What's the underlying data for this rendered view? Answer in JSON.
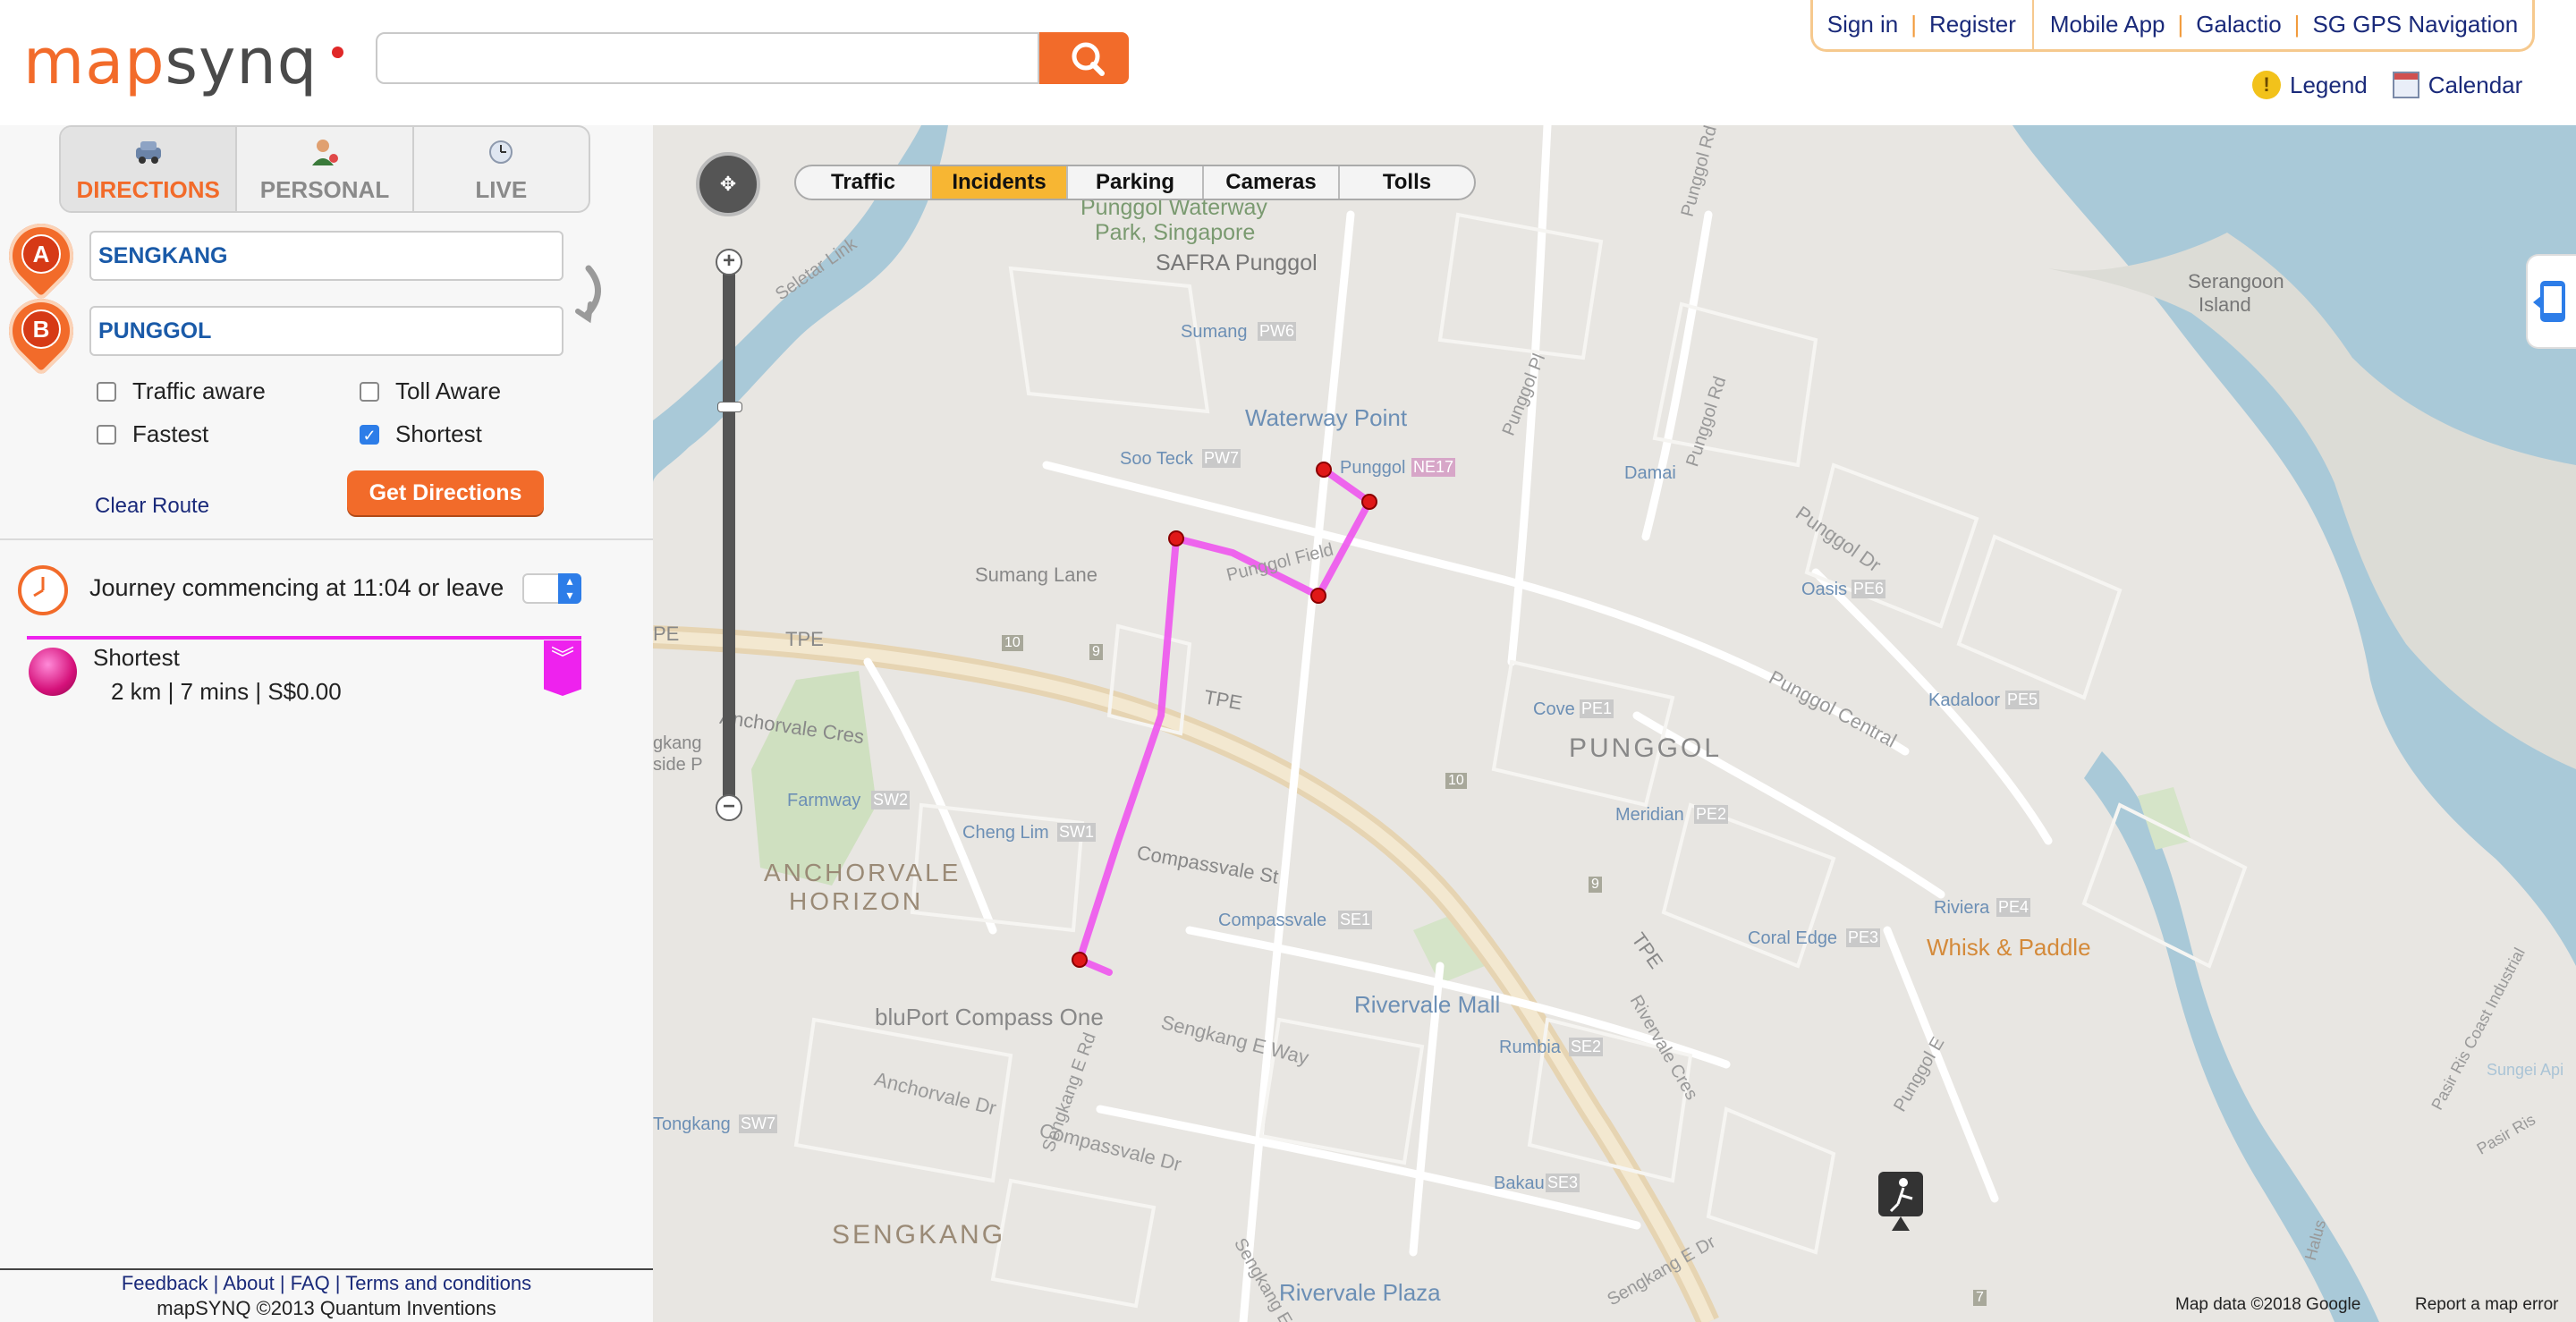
{
  "brand": {
    "logo_map": "map",
    "logo_synq": "synq"
  },
  "search": {
    "value": "",
    "placeholder": ""
  },
  "top_links": [
    "Sign in",
    "Register",
    "Mobile App",
    "Galactio",
    "SG GPS Navigation"
  ],
  "legend_label": "Legend",
  "calendar_label": "Calendar",
  "tabs": [
    {
      "label": "DIRECTIONS",
      "icon": "car-icon",
      "active": true
    },
    {
      "label": "PERSONAL",
      "icon": "person-icon",
      "active": false
    },
    {
      "label": "LIVE",
      "icon": "clock-icon",
      "active": false
    }
  ],
  "route": {
    "from_label": "A",
    "from_value": "SENGKANG",
    "to_label": "B",
    "to_value": "PUNGGOL",
    "options": [
      {
        "label": "Traffic aware",
        "checked": false
      },
      {
        "label": "Toll Aware",
        "checked": false
      },
      {
        "label": "Fastest",
        "checked": false
      },
      {
        "label": "Shortest",
        "checked": true
      }
    ],
    "clear_label": "Clear Route",
    "get_directions_label": "Get Directions"
  },
  "journey": {
    "text": "Journey commencing at 11:04 or leave",
    "select_value": ""
  },
  "result": {
    "name": "Shortest",
    "stats": "2 km | 7 mins | S$0.00",
    "color": "#ee22ee"
  },
  "footer": {
    "links": [
      "Feedback",
      "About",
      "FAQ",
      "Terms and conditions"
    ],
    "copyright": "mapSYNQ ©2013 Quantum Inventions"
  },
  "map": {
    "layers": [
      {
        "label": "Traffic",
        "active": false
      },
      {
        "label": "Incidents",
        "active": true
      },
      {
        "label": "Parking",
        "active": false
      },
      {
        "label": "Cameras",
        "active": false
      },
      {
        "label": "Tolls",
        "active": false
      }
    ],
    "zoom_level_fraction": 0.74,
    "labels": {
      "punggol_waterway": "Punggol Waterway",
      "park_singapore": "Park, Singapore",
      "safra": "SAFRA Punggol",
      "serangoon_island_1": "Serangoon",
      "serangoon_island_2": "Island",
      "seletar_link": "Seletar Link",
      "sumang": "Sumang",
      "pw6": "PW6",
      "waterway_point": "Waterway Point",
      "soo_teck": "Soo Teck",
      "pw7": "PW7",
      "punggol_stn": "Punggol",
      "ne17": "NE17",
      "damai": "Damai",
      "sumang_lane": "Sumang Lane",
      "punggol_field": "Punggol Field",
      "oasis": "Oasis",
      "pe6": "PE6",
      "tpe_1": "TPE",
      "tpe_2": "TPE",
      "tpe_3": "TPE",
      "tpe_4": "TPE",
      "r10a": "10",
      "r9a": "9",
      "r10b": "10",
      "r9b": "9",
      "r7": "7",
      "anchorvale_cres": "Anchorvale Cres",
      "cove": "Cove",
      "pe1": "PE1",
      "punggol": "PUNGGOL",
      "kadaloor": "Kadaloor",
      "pe5": "PE5",
      "punggol_central": "Punggol Central",
      "punggol_dr": "Punggol Dr",
      "punggol_rd_1": "Punggol Rd",
      "punggol_rd_2": "Punggol Rd",
      "punggol_pl": "Punggol Pl",
      "farmway": "Farmway",
      "sw2": "SW2",
      "meridian": "Meridian",
      "pe2": "PE2",
      "cheng_lim": "Cheng Lim",
      "sw1": "SW1",
      "compassvale_st": "Compassvale St",
      "compassvale": "Compassvale",
      "se1": "SE1",
      "anchorvale_1": "ANCHORVALE",
      "anchorvale_2": "HORIZON",
      "riviera": "Riviera",
      "pe4": "PE4",
      "whisk": "Whisk & Paddle",
      "coral_edge": "Coral Edge",
      "pe3": "PE3",
      "bluport": "bluPort Compass One",
      "rivervale_mall": "Rivervale Mall",
      "rumbia": "Rumbia",
      "se2": "SE2",
      "sengkang_e_way": "Sengkang E Way",
      "sengkang_e_rd": "Sengkang E Rd",
      "anchorvale_dr": "Anchorvale Dr",
      "compassvale_dr": "Compassvale Dr",
      "tongkang": "Tongkang",
      "sw7": "SW7",
      "bakau": "Bakau",
      "se3": "SE3",
      "sengkang": "SENGKANG",
      "rivervale_plaza": "Rivervale Plaza",
      "rivervale_cres": "Rivervale Cres",
      "punggol_e": "Punggol E",
      "pasir_ris": "Pasir Ris Coast Industrial",
      "pasir_ris_2": "Pasir Ris",
      "sungei": "Sungei Api",
      "gkang_1": "gkang",
      "gkang_2": "side P",
      "tpe_left": "PE",
      "halus": "Halus",
      "sengkang_e_dr": "Sengkang E Dr",
      "sengkang_e_av": "Sengkang E Av"
    },
    "attribution": "Map data ©2018 Google",
    "report_error": "Report a map error"
  }
}
